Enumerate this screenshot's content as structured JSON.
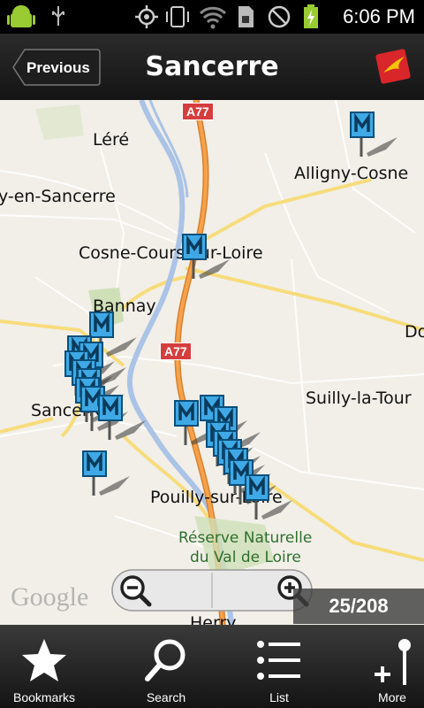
{
  "status_bar": {
    "time": "6:06 PM",
    "icons": [
      "android-icon",
      "usb-icon",
      "gps-icon",
      "vibrate-icon",
      "wifi-icon",
      "sim-icon",
      "no-signal-icon",
      "battery-charging-icon"
    ]
  },
  "header": {
    "previous_label": "Previous",
    "title": "Sancerre",
    "logo_icon": "app-logo-icon"
  },
  "map": {
    "places": {
      "lere": "Léré",
      "sury": "y-en-Sancerre",
      "alligny": "Alligny-Cosne",
      "cosne": "Cosne-Cours-sur-Loire",
      "bannay": "Bannay",
      "do": "Do",
      "sancerre": "Sancerre",
      "suilly": "Suilly-la-Tour",
      "pouilly": "Pouilly-sur-Loire",
      "reserve1": "Réserve Naturelle",
      "reserve2": "du Val de Loire",
      "herry": "Herry"
    },
    "roads": {
      "a77_top": "A77",
      "a77_mid": "A77"
    },
    "attribution": "Google",
    "counter": "25/208",
    "accent": "#3fa9e6"
  },
  "toolbar": {
    "items": [
      {
        "label": "Bookmarks",
        "icon": "star-icon"
      },
      {
        "label": "Search",
        "icon": "search-icon"
      },
      {
        "label": "List",
        "icon": "list-icon"
      },
      {
        "label": "More",
        "icon": "more-icon"
      }
    ]
  }
}
